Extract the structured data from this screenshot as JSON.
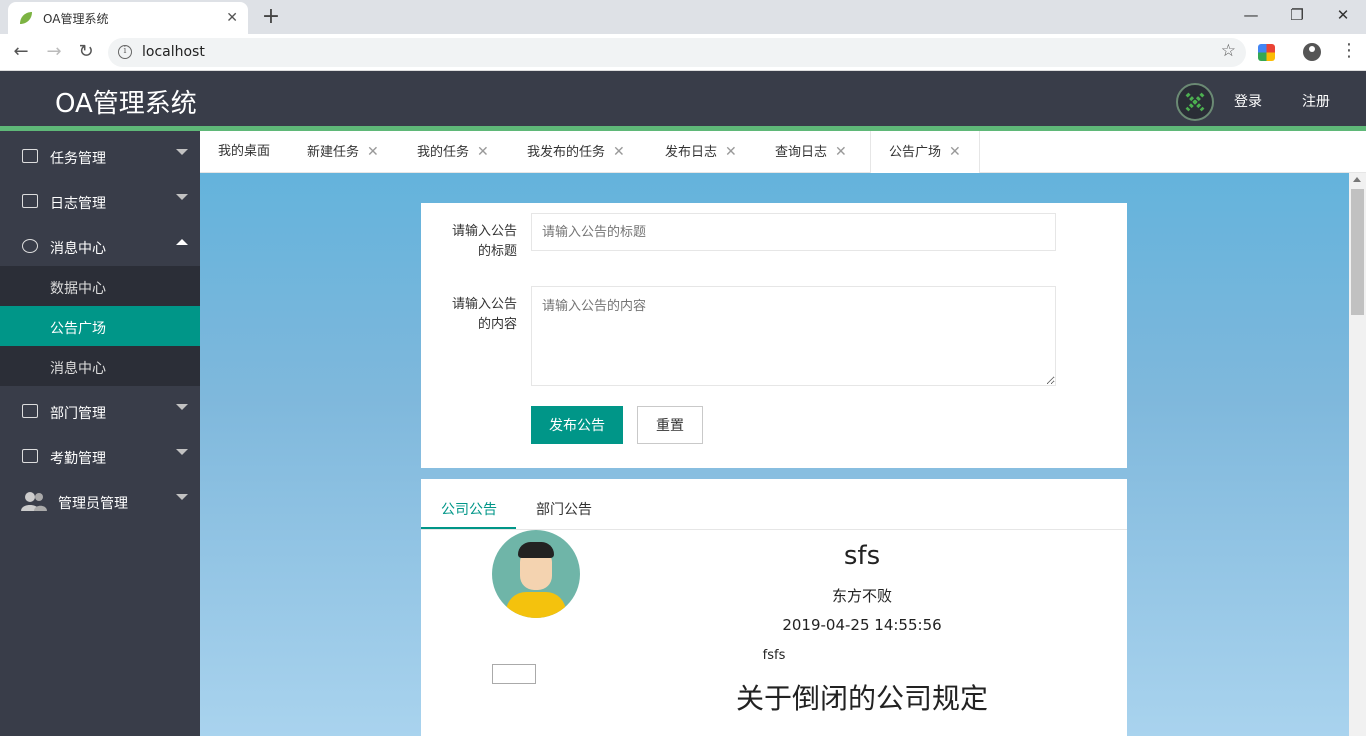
{
  "browser": {
    "tab_title": "OA管理系统",
    "url": "localhost"
  },
  "header": {
    "logo": "OA管理系统",
    "login": "登录",
    "register": "注册"
  },
  "sidebar": {
    "items": [
      {
        "label": "任务管理"
      },
      {
        "label": "日志管理"
      },
      {
        "label": "消息中心"
      },
      {
        "label": "部门管理"
      },
      {
        "label": "考勤管理"
      },
      {
        "label": "管理员管理"
      }
    ],
    "sub_items": [
      {
        "label": "数据中心"
      },
      {
        "label": "公告广场"
      },
      {
        "label": "消息中心"
      }
    ]
  },
  "tabs": [
    {
      "label": "我的桌面"
    },
    {
      "label": "新建任务"
    },
    {
      "label": "我的任务"
    },
    {
      "label": "我发布的任务"
    },
    {
      "label": "发布日志"
    },
    {
      "label": "查询日志"
    },
    {
      "label": "公告广场"
    }
  ],
  "form": {
    "title_label_1": "请输入公告",
    "title_label_2": "的标题",
    "title_placeholder": "请输入公告的标题",
    "content_label_1": "请输入公告",
    "content_label_2": "的内容",
    "content_placeholder": "请输入公告的内容",
    "submit": "发布公告",
    "reset": "重置"
  },
  "notices": {
    "tabs": [
      "公司公告",
      "部门公告"
    ],
    "first": {
      "title": "sfs",
      "author": "东方不败",
      "time": "2019-04-25 14:55:56",
      "content": "fsfs"
    },
    "second": {
      "title": "关于倒闭的公司规定"
    }
  },
  "colors": {
    "header_bg": "#393d49",
    "accent": "#009688",
    "header_line": "#5fb878"
  }
}
